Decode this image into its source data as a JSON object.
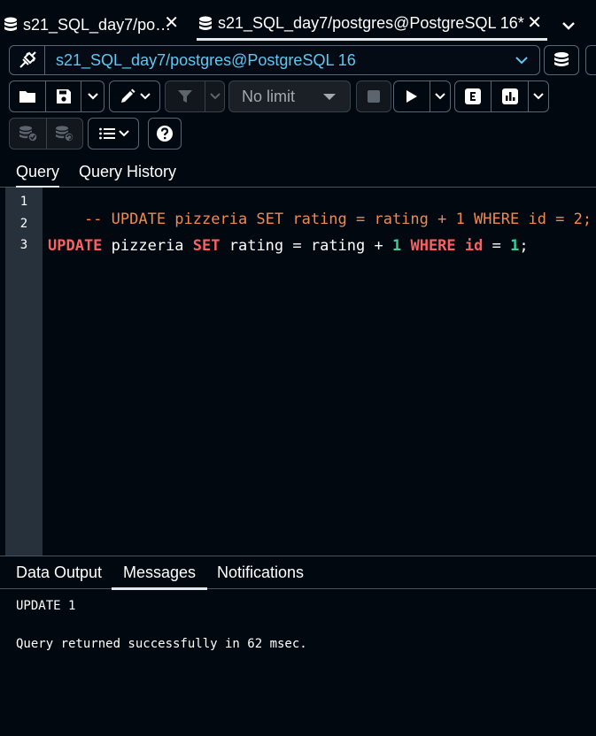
{
  "tabs": [
    {
      "title": "s21_SQL_day7/po…",
      "active": false
    },
    {
      "title": "s21_SQL_day7/postgres@PostgreSQL 16*",
      "active": true
    }
  ],
  "connection": {
    "label": "s21_SQL_day7/postgres@PostgreSQL 16",
    "color": "#5ec8f2"
  },
  "toolbar": {
    "limit_label": "No limit",
    "icons": [
      "open-file-icon",
      "save-icon",
      "chevron-down-icon",
      "edit-pen-icon",
      "filter-icon",
      "stop-icon",
      "play-icon",
      "explain-icon",
      "explain-analyze-icon",
      "commit-icon",
      "rollback-icon",
      "macros-icon",
      "help-icon"
    ]
  },
  "editor_tabs": [
    {
      "label": "Query",
      "active": true
    },
    {
      "label": "Query History",
      "active": false
    }
  ],
  "editor": {
    "lines": [
      {
        "number": "1",
        "tokens": [
          {
            "text": "-- UPDATE pizzeria SET rating = rating + 1 WHERE id = 2;",
            "type": "comment"
          }
        ]
      },
      {
        "number": "2",
        "tokens": []
      },
      {
        "number": "3",
        "tokens": [
          {
            "text": "UPDATE",
            "type": "kw"
          },
          {
            "text": " pizzeria ",
            "type": "plain"
          },
          {
            "text": "SET",
            "type": "kw"
          },
          {
            "text": " rating = rating + ",
            "type": "plain"
          },
          {
            "text": "1",
            "type": "num"
          },
          {
            "text": " ",
            "type": "plain"
          },
          {
            "text": "WHERE",
            "type": "kw"
          },
          {
            "text": " ",
            "type": "plain"
          },
          {
            "text": "id",
            "type": "kw"
          },
          {
            "text": " = ",
            "type": "plain"
          },
          {
            "text": "1",
            "type": "num"
          },
          {
            "text": ";",
            "type": "plain"
          }
        ]
      }
    ],
    "colors": {
      "comment": "#f0894f",
      "keyword": "#ff5f5f",
      "number": "#34d399",
      "gutter": "#27313c"
    }
  },
  "result_tabs": [
    {
      "label": "Data Output",
      "active": false
    },
    {
      "label": "Messages",
      "active": true
    },
    {
      "label": "Notifications",
      "active": false
    }
  ],
  "messages": {
    "line1": "UPDATE 1",
    "line2": "Query returned successfully in 62 msec."
  }
}
